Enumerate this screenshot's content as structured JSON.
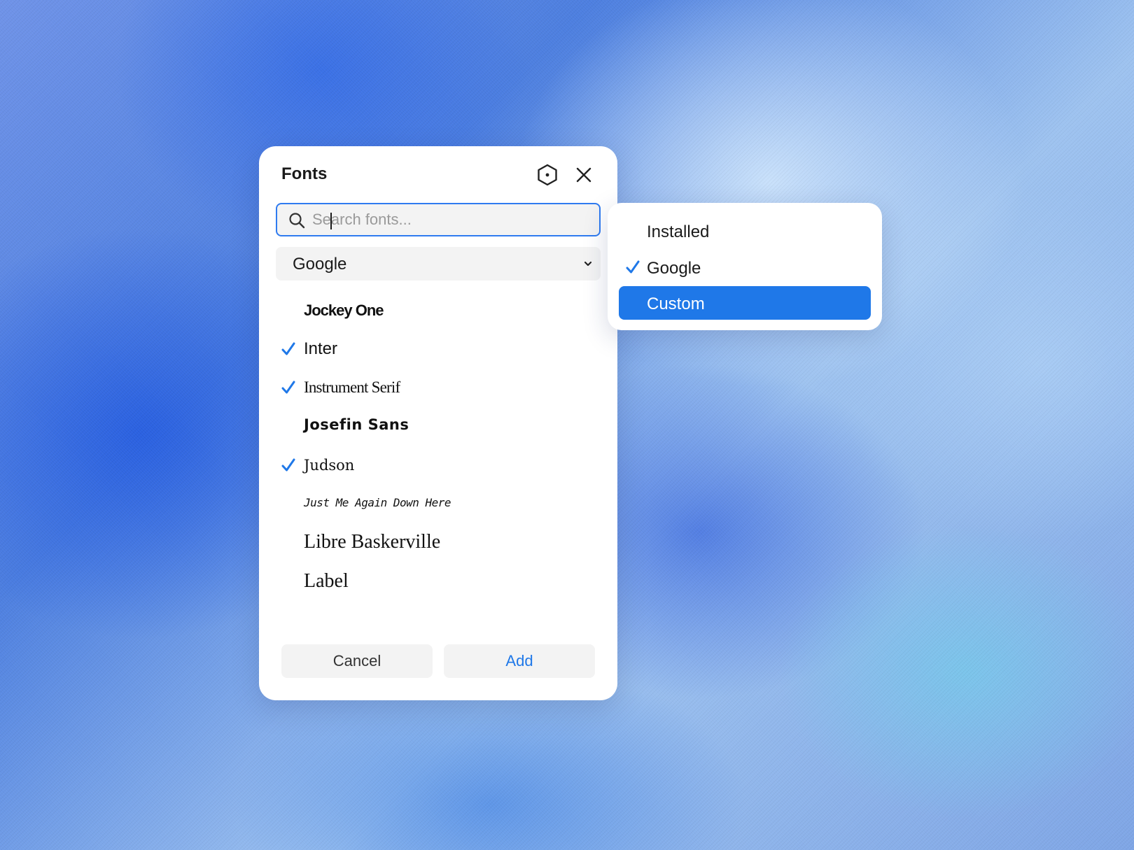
{
  "colors": {
    "accent": "#1f78e8",
    "focus_border": "#2f7bf0",
    "field_bg": "#f3f3f3"
  },
  "dialog": {
    "title": "Fonts",
    "icons": [
      "hexagon-settings-icon",
      "close-icon"
    ],
    "search": {
      "placeholder": "Search fonts...",
      "value": ""
    },
    "source_select": {
      "selected": "Google",
      "icon": "chevron-down-icon"
    },
    "fonts": [
      {
        "label": "Jockey One",
        "checked": false
      },
      {
        "label": "Inter",
        "checked": true
      },
      {
        "label": "Instrument Serif",
        "checked": true
      },
      {
        "label": "Josefin Sans",
        "checked": false
      },
      {
        "label": "Judson",
        "checked": true
      },
      {
        "label": "Just Me Again Down Here",
        "checked": false
      },
      {
        "label": "Libre Baskerville",
        "checked": false
      },
      {
        "label": "Label",
        "checked": false
      }
    ],
    "buttons": {
      "cancel": "Cancel",
      "add": "Add"
    }
  },
  "source_dropdown": {
    "options": [
      {
        "label": "Installed",
        "checked": false,
        "highlighted": false
      },
      {
        "label": "Google",
        "checked": true,
        "highlighted": false
      },
      {
        "label": "Custom",
        "checked": false,
        "highlighted": true
      }
    ]
  }
}
